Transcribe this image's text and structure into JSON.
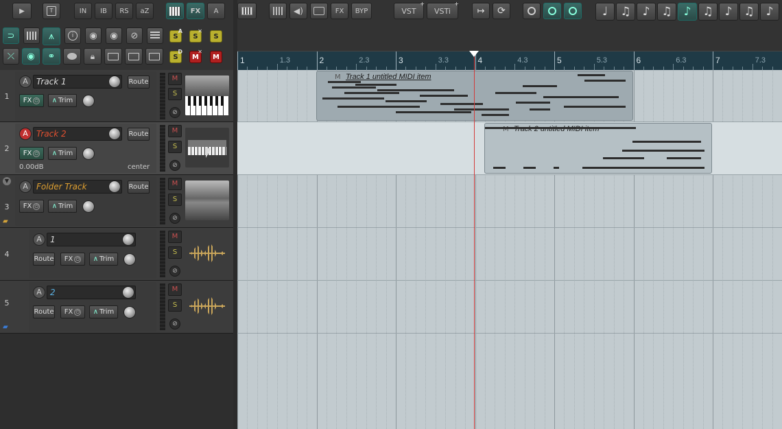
{
  "toolbar": {
    "transport_play": "▶",
    "row1_buttons": [
      "IN",
      "IB",
      "RS",
      "aZ"
    ],
    "fx_label": "FX",
    "a_label": "A",
    "fx2_label": "FX",
    "byp_label": "BYP",
    "vst_label": "VST",
    "vsti_label": "VSTi",
    "solo_labels": [
      "S",
      "S",
      "S"
    ],
    "solo_sup_a": "A",
    "solo_sup_x": "✕",
    "solo_sup_d": "D",
    "mute_labels": [
      "M",
      "M"
    ],
    "mute_sup_x": "✕"
  },
  "ruler": {
    "labels": [
      "1",
      "1.3",
      "2",
      "2.3",
      "3",
      "3.3",
      "4",
      "4.3",
      "5",
      "5.3",
      "6",
      "6.3",
      "7",
      "7.3"
    ]
  },
  "tracks": [
    {
      "num": "1",
      "name": "Track 1",
      "route": "Route",
      "fx": "FX",
      "trim": "Trim",
      "arm": "A",
      "m": "M",
      "s": "S",
      "phase": "⊘"
    },
    {
      "num": "2",
      "name": "Track 2",
      "route": "Route",
      "fx": "FX",
      "trim": "Trim",
      "arm": "A",
      "volume": "0.00dB",
      "pan": "center",
      "m": "M",
      "s": "S",
      "phase": "⊘"
    },
    {
      "num": "3",
      "name": "Folder Track",
      "route": "Route",
      "fx": "FX",
      "trim": "Trim",
      "arm": "A",
      "m": "M",
      "s": "S",
      "phase": "⊘"
    },
    {
      "num": "4",
      "name": "1",
      "route": "Route",
      "fx": "FX",
      "trim": "Trim",
      "arm": "A",
      "m": "M",
      "s": "S",
      "phase": "⊘"
    },
    {
      "num": "5",
      "name": "2",
      "route": "Route",
      "fx": "FX",
      "trim": "Trim",
      "arm": "A",
      "m": "M",
      "s": "S",
      "phase": "⊘"
    }
  ],
  "items": [
    {
      "title": "Track 1 untitled MIDI item",
      "mute": "M"
    },
    {
      "title": "Track 2 untitled MIDI item",
      "mute": "M"
    }
  ],
  "colors": {
    "accent_teal": "#1e6c66",
    "armed_red": "#c03030",
    "track2_name": "#e05030",
    "folder_name": "#e0a030",
    "child_name": "#5ab0e0",
    "cursor": "#d23a3a"
  }
}
